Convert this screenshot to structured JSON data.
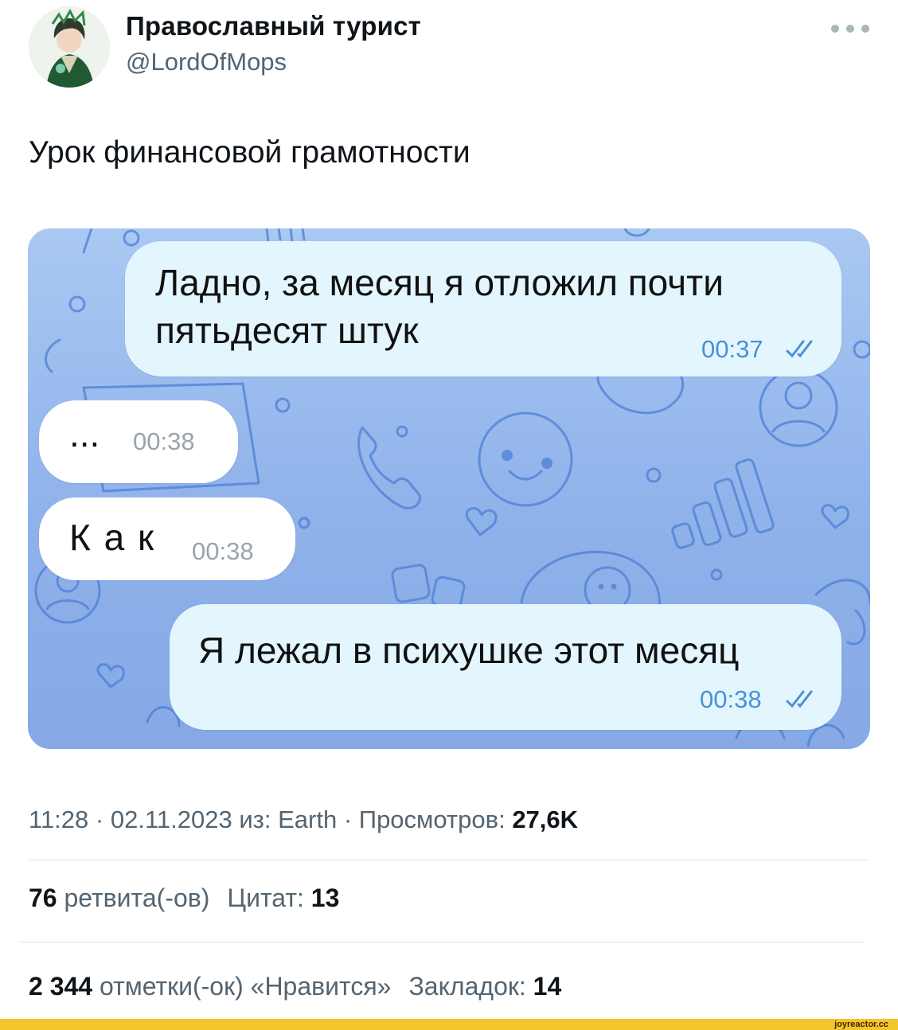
{
  "tweet": {
    "display_name": "Православный турист",
    "handle": "@LordOfMops",
    "text": "Урок финансовой грамотности",
    "avatar_icon": "avatar-illustration",
    "more_icon": "more-horizontal-icon"
  },
  "chat": {
    "messages": [
      {
        "direction": "outgoing",
        "lines": [
          "Ладно, за месяц я отложил почти",
          "пятьдесят штук"
        ],
        "time": "00:37",
        "status": "read"
      },
      {
        "direction": "incoming",
        "text": "...",
        "time": "00:38"
      },
      {
        "direction": "incoming",
        "text": "К а к",
        "time": "00:38"
      },
      {
        "direction": "outgoing",
        "text": "Я лежал в психушке этот месяц",
        "time": "00:38",
        "status": "read"
      }
    ],
    "colors": {
      "background": "#98b9ee",
      "outgoing_bubble": "#e3f6fd",
      "incoming_bubble": "#ffffff",
      "outgoing_time": "#4a90d8",
      "doodle_stroke": "#4c7fd6"
    }
  },
  "meta": {
    "time": "11:28",
    "date": "02.11.2023",
    "source_prefix": "из:",
    "source": "Earth",
    "views_label": "Просмотров:",
    "views": "27,6K"
  },
  "stats": {
    "retweets_count": "76",
    "retweets_label": "ретвита(-ов)",
    "quotes_label": "Цитат:",
    "quotes_count": "13",
    "likes_count": "2 344",
    "likes_label": "отметки(-ок) «Нравится»",
    "bookmarks_label": "Закладок:",
    "bookmarks_count": "14"
  },
  "footer": {
    "watermark": "joyreactor.cc",
    "bar_color": "#f6c42b"
  }
}
